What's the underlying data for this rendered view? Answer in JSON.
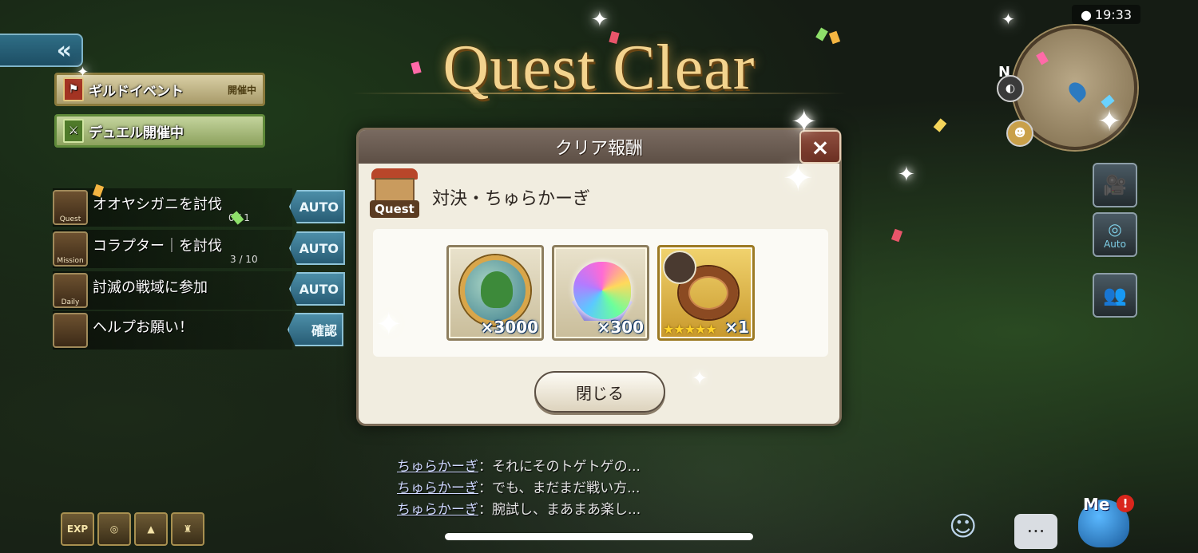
{
  "nav": {
    "back_label": "«"
  },
  "banners": {
    "guild": {
      "label": "ギルドイベント",
      "status": "開催中"
    },
    "duel": {
      "label": "デュエル開催中"
    }
  },
  "quests": [
    {
      "icon_label": "Quest",
      "text": "オオヤシガニを討伐",
      "progress": "0 / 1",
      "action": "AUTO"
    },
    {
      "icon_label": "Mission",
      "text": "コラプター｜を討伐",
      "progress": "3 / 10",
      "action": "AUTO"
    },
    {
      "icon_label": "Daily",
      "text": "討滅の戦域に参加",
      "progress": "",
      "action": "AUTO"
    },
    {
      "icon_label": "",
      "text": "ヘルプお願い！",
      "progress": "",
      "action": "確認"
    }
  ],
  "title": "Quest Clear",
  "dialog": {
    "header": "クリア報酬",
    "close_icon": "×",
    "quest_badge": "Quest",
    "quest_name": "対決・ちゅらかーぎ",
    "rewards": [
      {
        "name": "coin-medal",
        "count": "×3000"
      },
      {
        "name": "rainbow-orb",
        "count": "×300"
      },
      {
        "name": "bracelet",
        "count": "×1",
        "stars": "★★★★★"
      }
    ],
    "close_button": "閉じる"
  },
  "chat": [
    {
      "speaker": "ちゅらかーぎ",
      "message": "：それにそのトゲトゲの..."
    },
    {
      "speaker": "ちゅらかーぎ",
      "message": "：でも、まだまだ戦い方..."
    },
    {
      "speaker": "ちゅらかーぎ",
      "message": "：腕試し、まあまあ楽し..."
    }
  ],
  "status_bar": {
    "time": "19:33"
  },
  "minimap": {
    "north_label": "N"
  },
  "side_buttons": {
    "auto_label": "Auto"
  },
  "bottom_bar": {
    "exp_label": "EXP",
    "me_label": "Me"
  },
  "colors": {
    "accent_gold": "#f3d38e",
    "auto_blue": "#285d75",
    "dialog_bg": "#f1ede0"
  }
}
